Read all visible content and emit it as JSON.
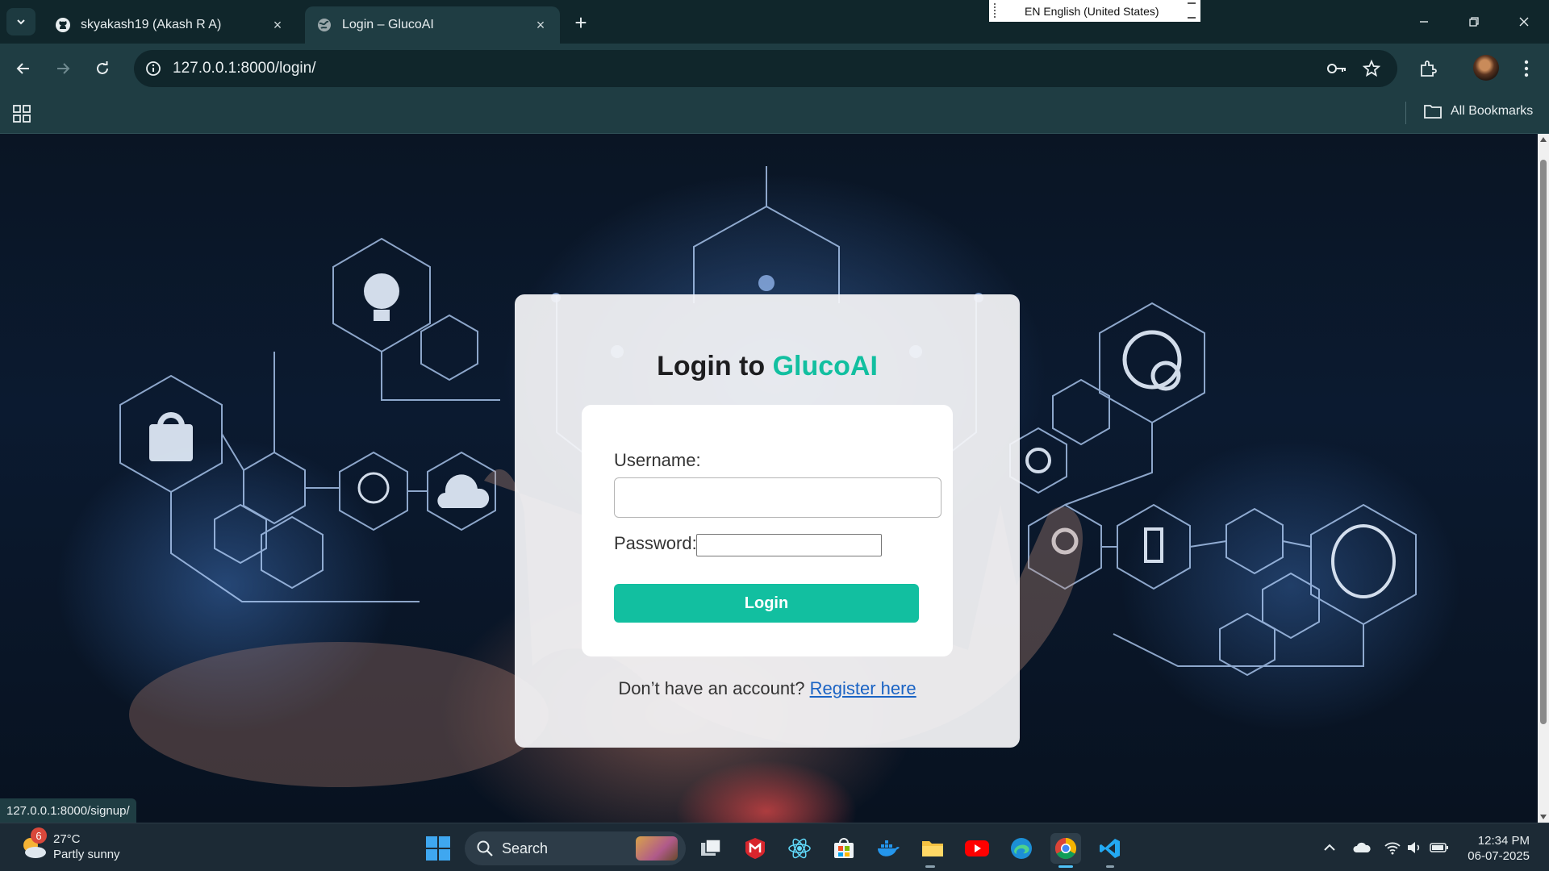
{
  "browser": {
    "tabs": [
      {
        "title": "skyakash19 (Akash R A)",
        "icon": "github-icon",
        "active": false
      },
      {
        "title": "Login – GlucoAI",
        "icon": "globe-icon",
        "active": true
      }
    ],
    "url": "127.0.0.1:8000/login/",
    "all_bookmarks_label": "All Bookmarks",
    "language_indicator": "EN English (United States)",
    "status_url": "127.0.0.1:8000/signup/"
  },
  "page": {
    "title_prefix": "Login to ",
    "brand": "GlucoAI",
    "username_label": "Username:",
    "username_value": "",
    "password_label": "Password:",
    "password_value": "",
    "login_button": "Login",
    "signup_prompt": "Don’t have an account? ",
    "register_link": "Register here",
    "accent_color": "#12bfa0",
    "link_color": "#1a63c4"
  },
  "taskbar": {
    "weather_temp": "27°C",
    "weather_desc": "Partly sunny",
    "weather_badge": "6",
    "search_placeholder": "Search",
    "time": "12:34 PM",
    "date": "06-07-2025",
    "apps": [
      "task-view",
      "mcafee",
      "react",
      "microsoft-store",
      "docker",
      "file-explorer",
      "youtube",
      "edge",
      "chrome",
      "vscode"
    ]
  }
}
